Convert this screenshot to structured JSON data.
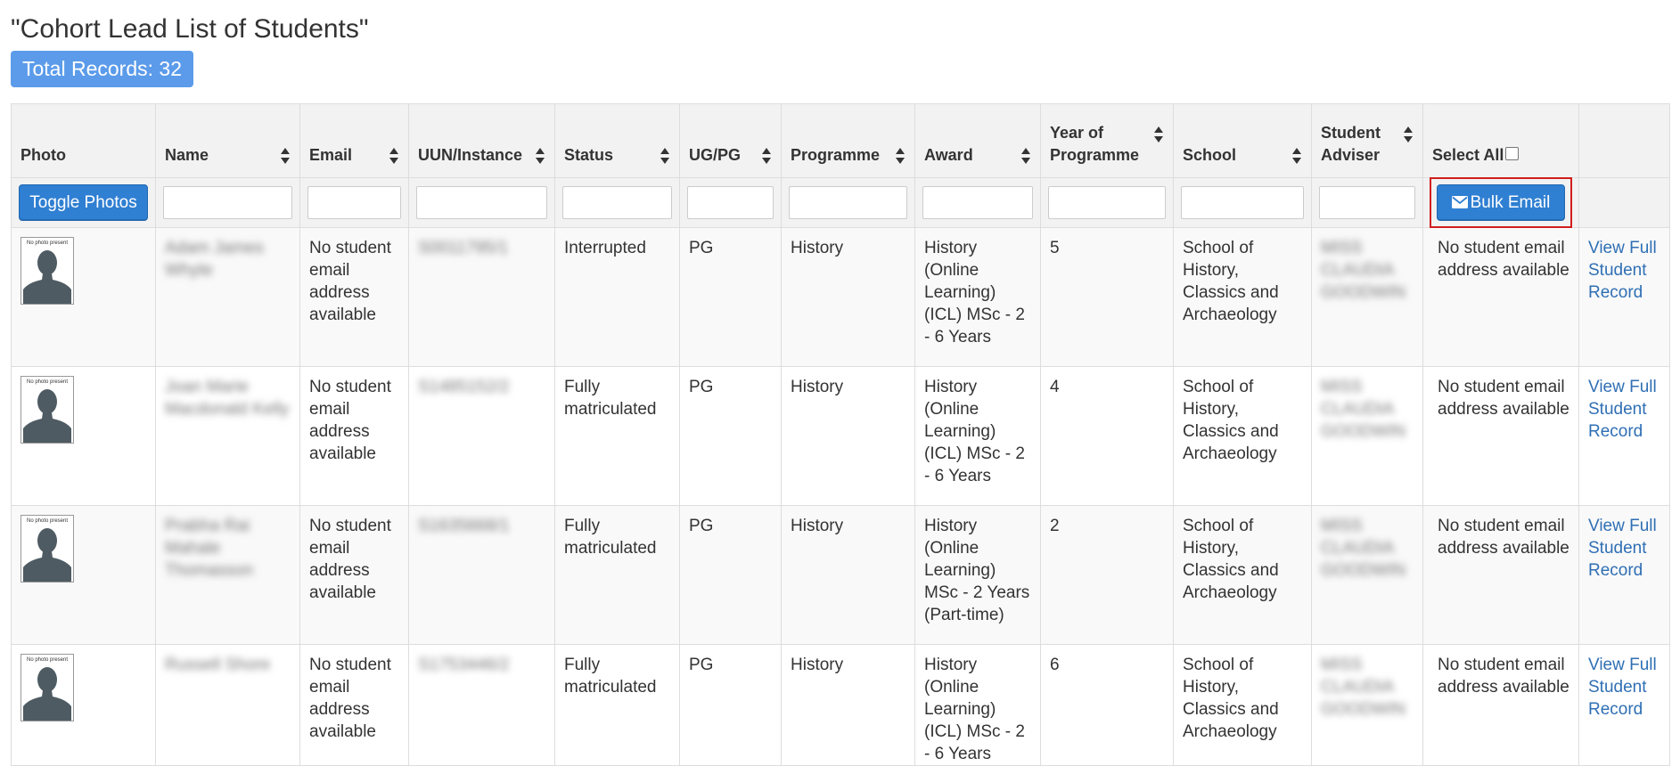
{
  "page": {
    "title": "\"Cohort Lead List of Students\"",
    "total_records": "Total Records: 32"
  },
  "table": {
    "headers": {
      "photo": "Photo",
      "name": "Name",
      "email": "Email",
      "uun": "UUN/Instance",
      "status": "Status",
      "ugpg": "UG/PG",
      "programme": "Programme",
      "award": "Award",
      "year": "Year of Programme",
      "school": "School",
      "adviser": "Student Adviser",
      "select_all": "Select All"
    },
    "toggle_photos": "Toggle Photos",
    "bulk_email": "Bulk Email",
    "rows": [
      {
        "photo_label": "No photo present",
        "name": "Adam James Whyte",
        "email": "No student email address available",
        "uun": "S0011795/1",
        "status": "Interrupted",
        "ugpg": "PG",
        "programme": "History",
        "award": "History (Online Learning)(ICL) MSc - 2 - 6 Years",
        "year": "5",
        "school": "School of History, Classics and Archaeology",
        "adviser": "MISS CLAUDIA GOODWIN",
        "email_status": "No student email address available",
        "record_link": "View Full Student Record"
      },
      {
        "photo_label": "No photo present",
        "name": "Joan Marie Macdonald Kelly",
        "email": "No student email address available",
        "uun": "S1485152/2",
        "status": "Fully matriculated",
        "ugpg": "PG",
        "programme": "History",
        "award": "History (Online Learning)(ICL) MSc - 2 - 6 Years",
        "year": "4",
        "school": "School of History, Classics and Archaeology",
        "adviser": "MISS CLAUDIA GOODWIN",
        "email_status": "No student email address available",
        "record_link": "View Full Student Record"
      },
      {
        "photo_label": "No photo present",
        "name": "Prabha Rai Mahale Thomasson",
        "email": "No student email address available",
        "uun": "S1635668/1",
        "status": "Fully matriculated",
        "ugpg": "PG",
        "programme": "History",
        "award": "History (Online Learning) MSc - 2 Years (Part-time)",
        "year": "2",
        "school": "School of History, Classics and Archaeology",
        "adviser": "MISS CLAUDIA GOODWIN",
        "email_status": "No student email address available",
        "record_link": "View Full Student Record"
      },
      {
        "photo_label": "No photo present",
        "name": "Russell Shore",
        "email": "No student email address available",
        "uun": "S1753446/2",
        "status": "Fully matriculated",
        "ugpg": "PG",
        "programme": "History",
        "award": "History (Online Learning)(ICL) MSc - 2 - 6 Years",
        "year": "6",
        "school": "School of History, Classics and Archaeology",
        "adviser": "MISS CLAUDIA GOODWIN",
        "email_status": "No student email address available",
        "record_link": "View Full Student Record"
      }
    ]
  }
}
